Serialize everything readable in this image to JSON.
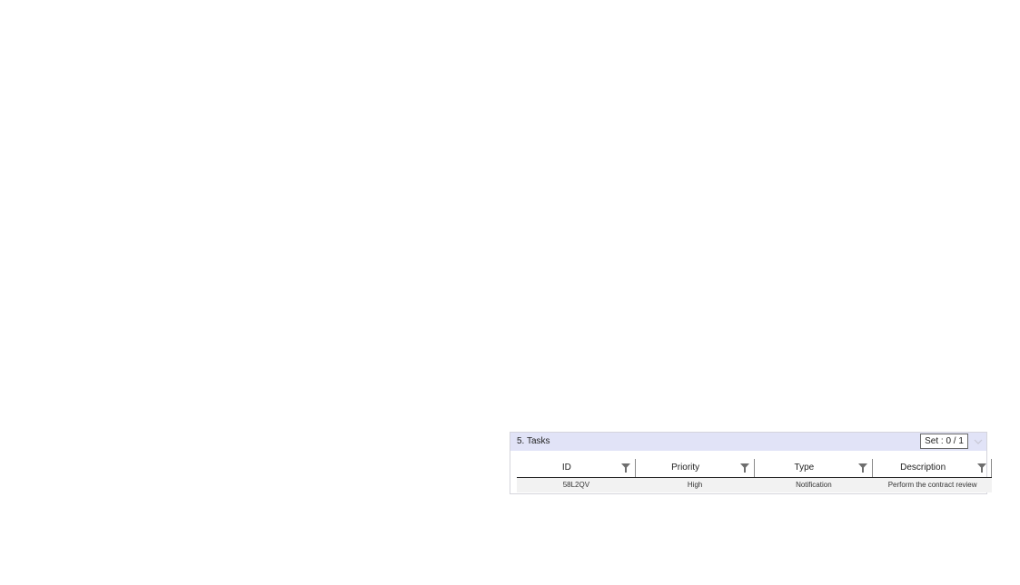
{
  "panel": {
    "title": "5. Tasks",
    "set_label": "Set : 0 / 1"
  },
  "table": {
    "columns": [
      "ID",
      "Priority",
      "Type",
      "Description"
    ],
    "rows": [
      [
        "58L2QV",
        "High",
        "Notification",
        "Perform the contract review"
      ]
    ]
  },
  "icons": {
    "filter": "filter-icon",
    "collapse": "chevron-down-icon"
  },
  "colors": {
    "header_bg": "#e1e3f7",
    "row_bg": "#f2f2f2",
    "icon": "#6e6e6e"
  }
}
